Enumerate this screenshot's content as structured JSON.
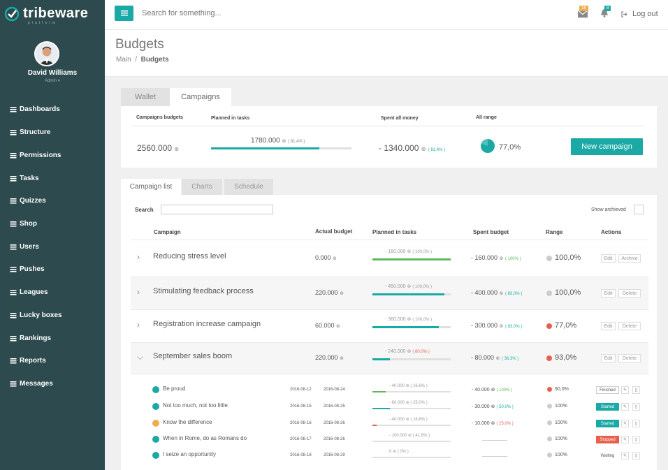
{
  "brand": {
    "name": "tribeware",
    "sub": "platform"
  },
  "user": {
    "name": "David Williams",
    "role": "Admin ▾"
  },
  "nav": [
    {
      "label": "Dashboards",
      "icon": "dashboard-icon"
    },
    {
      "label": "Structure",
      "icon": "structure-icon"
    },
    {
      "label": "Permissions",
      "icon": "lock-icon"
    },
    {
      "label": "Tasks",
      "icon": "tasks-icon"
    },
    {
      "label": "Quizzes",
      "icon": "question-icon"
    },
    {
      "label": "Shop",
      "icon": "cart-icon"
    },
    {
      "label": "Users",
      "icon": "users-icon"
    },
    {
      "label": "Pushes",
      "icon": "envelope-icon"
    },
    {
      "label": "Leagues",
      "icon": "trophy-icon"
    },
    {
      "label": "Lucky boxes",
      "icon": "box-icon"
    },
    {
      "label": "Rankings",
      "icon": "list-icon"
    },
    {
      "label": "Reports",
      "icon": "chart-icon"
    },
    {
      "label": "Messages",
      "icon": "bell-icon"
    }
  ],
  "topbar": {
    "search_placeholder": "Search for something...",
    "mail_count": "16",
    "notif_count": "8",
    "logout": "Log out"
  },
  "page": {
    "title": "Budgets",
    "breadcrumb_main": "Main",
    "breadcrumb_sep": "/",
    "breadcrumb_current": "Budgets"
  },
  "top_tabs": {
    "wallet": "Wallet",
    "campaigns": "Campaigns"
  },
  "summary": {
    "campaigns_budgets_label": "Campaigns budgets",
    "planned_label": "Planned in tasks",
    "spent_label": "Spent all money",
    "range_label": "All range",
    "campaigns_budgets": "2560.000",
    "planned": "1780.000",
    "planned_pct": "( 81,4% )",
    "planned_fill": 0.77,
    "spent": "- 1340.000",
    "spent_pct": "( 81,4% )",
    "range": "77,0%",
    "new_campaign": "New campaign"
  },
  "sub_tabs": {
    "list": "Campaign list",
    "charts": "Charts",
    "schedule": "Schedule"
  },
  "filters": {
    "search_label": "Search",
    "show_archived": "Show archieved"
  },
  "columns": {
    "campaign": "Campaign",
    "actual": "Actual budget",
    "planned": "Planned in tasks",
    "spent": "Spent budget",
    "range": "Range",
    "actions": "Actions"
  },
  "campaigns": [
    {
      "name": "Reducing stress level",
      "actual": "0.000",
      "planned": "- 160.000",
      "planned_pct": "( 100,0% )",
      "fill": 1.0,
      "fill_color": "#5cb85c",
      "spent": "- 160.000",
      "spent_pct": "( 100% )",
      "spent_pct_color": "#5cb85c",
      "range": "100,0%",
      "a1": "Edit",
      "a2": "Archive"
    },
    {
      "name": "Stimulating feedback process",
      "actual": "220.000",
      "planned": "- 450.000",
      "planned_pct": "( 100,0% )",
      "fill": 0.92,
      "fill_color": "#1aa9a4",
      "spent": "- 400.000",
      "spent_pct": "( 83,0% )",
      "spent_pct_color": "#1aa9a4",
      "range": "100,0%",
      "a1": "Edit",
      "a2": "Delete"
    },
    {
      "name": "Registration increase campaign",
      "actual": "60.000",
      "planned": "- 360.000",
      "planned_pct": "( 100,0% )",
      "fill": 0.85,
      "fill_color": "#1aa9a4",
      "spent": "- 300.000",
      "spent_pct": "( 83,0% )",
      "spent_pct_color": "#1aa9a4",
      "range": "77,0%",
      "a1": "Edit",
      "a2": "Delete"
    },
    {
      "name": "September sales boom",
      "actual": "220.000",
      "planned": "- 240.000",
      "planned_pct": "( 80,0% )",
      "fill": 0.22,
      "fill_color": "#1aa9a4",
      "spent": "- 80.000",
      "spent_pct": "( 36,3% )",
      "spent_pct_color": "#1aa9a4",
      "range": "93,0%",
      "a1": "Edit",
      "a2": "Delete"
    }
  ],
  "tasks": [
    {
      "name": "Be proud",
      "start": "2016-08-12",
      "end": "2016-08-24",
      "planned": "- 40.000",
      "pct": "( 16,6% )",
      "fill": 0.17,
      "fill_color": "#5cb85c",
      "spent": "- 40.000",
      "spent_pct": "( 100% )",
      "spent_color": "#5cb85c",
      "range": "90,0%",
      "status": "Finished",
      "icon_color": "#1aa9a4"
    },
    {
      "name": "Not too much, not too little",
      "start": "2016-08-15",
      "end": "2016-08-25",
      "planned": "- 60.000",
      "pct": "( 25,0% )",
      "fill": 0.22,
      "fill_color": "#1aa9a4",
      "spent": "- 30.000",
      "spent_pct": "( 50,0% )",
      "spent_color": "#1aa9a4",
      "range": "100%",
      "status": "Started",
      "icon_color": "#1aa9a4"
    },
    {
      "name": "Know the difference",
      "start": "2016-08-16",
      "end": "2016-08-26",
      "planned": "- 40.000",
      "pct": "( 16,6% )",
      "fill": 0.05,
      "fill_color": "#e8604c",
      "spent": "- 10.000",
      "spent_pct": "( 25,0% )",
      "spent_color": "#e8604c",
      "range": "100%",
      "status": "Started",
      "icon_color": "#f0ad4e"
    },
    {
      "name": "When in Rome, do as Romans do",
      "start": "2016-08-17",
      "end": "2016-08-26",
      "planned": "- 100.000",
      "pct": "( 41,6% )",
      "fill": 0.0,
      "fill_color": "#1aa9a4",
      "spent": "",
      "spent_pct": "",
      "spent_color": "#1aa9a4",
      "range": "100%",
      "status": "Stopped",
      "icon_color": "#1aa9a4"
    },
    {
      "name": "I seize an opportunity",
      "start": "2016-08-18",
      "end": "2016-08-29",
      "planned": "0",
      "pct": "( 0% )",
      "fill": 0.0,
      "fill_color": "#1aa9a4",
      "spent": "",
      "spent_pct": "",
      "spent_color": "#1aa9a4",
      "range": "100%",
      "status": "Waiting",
      "icon_color": "#1aa9a4"
    }
  ],
  "colors": {
    "accent": "#1aa9a4",
    "sidebar": "#2d4a4e",
    "danger": "#e8604c",
    "warning": "#f0ad4e"
  }
}
